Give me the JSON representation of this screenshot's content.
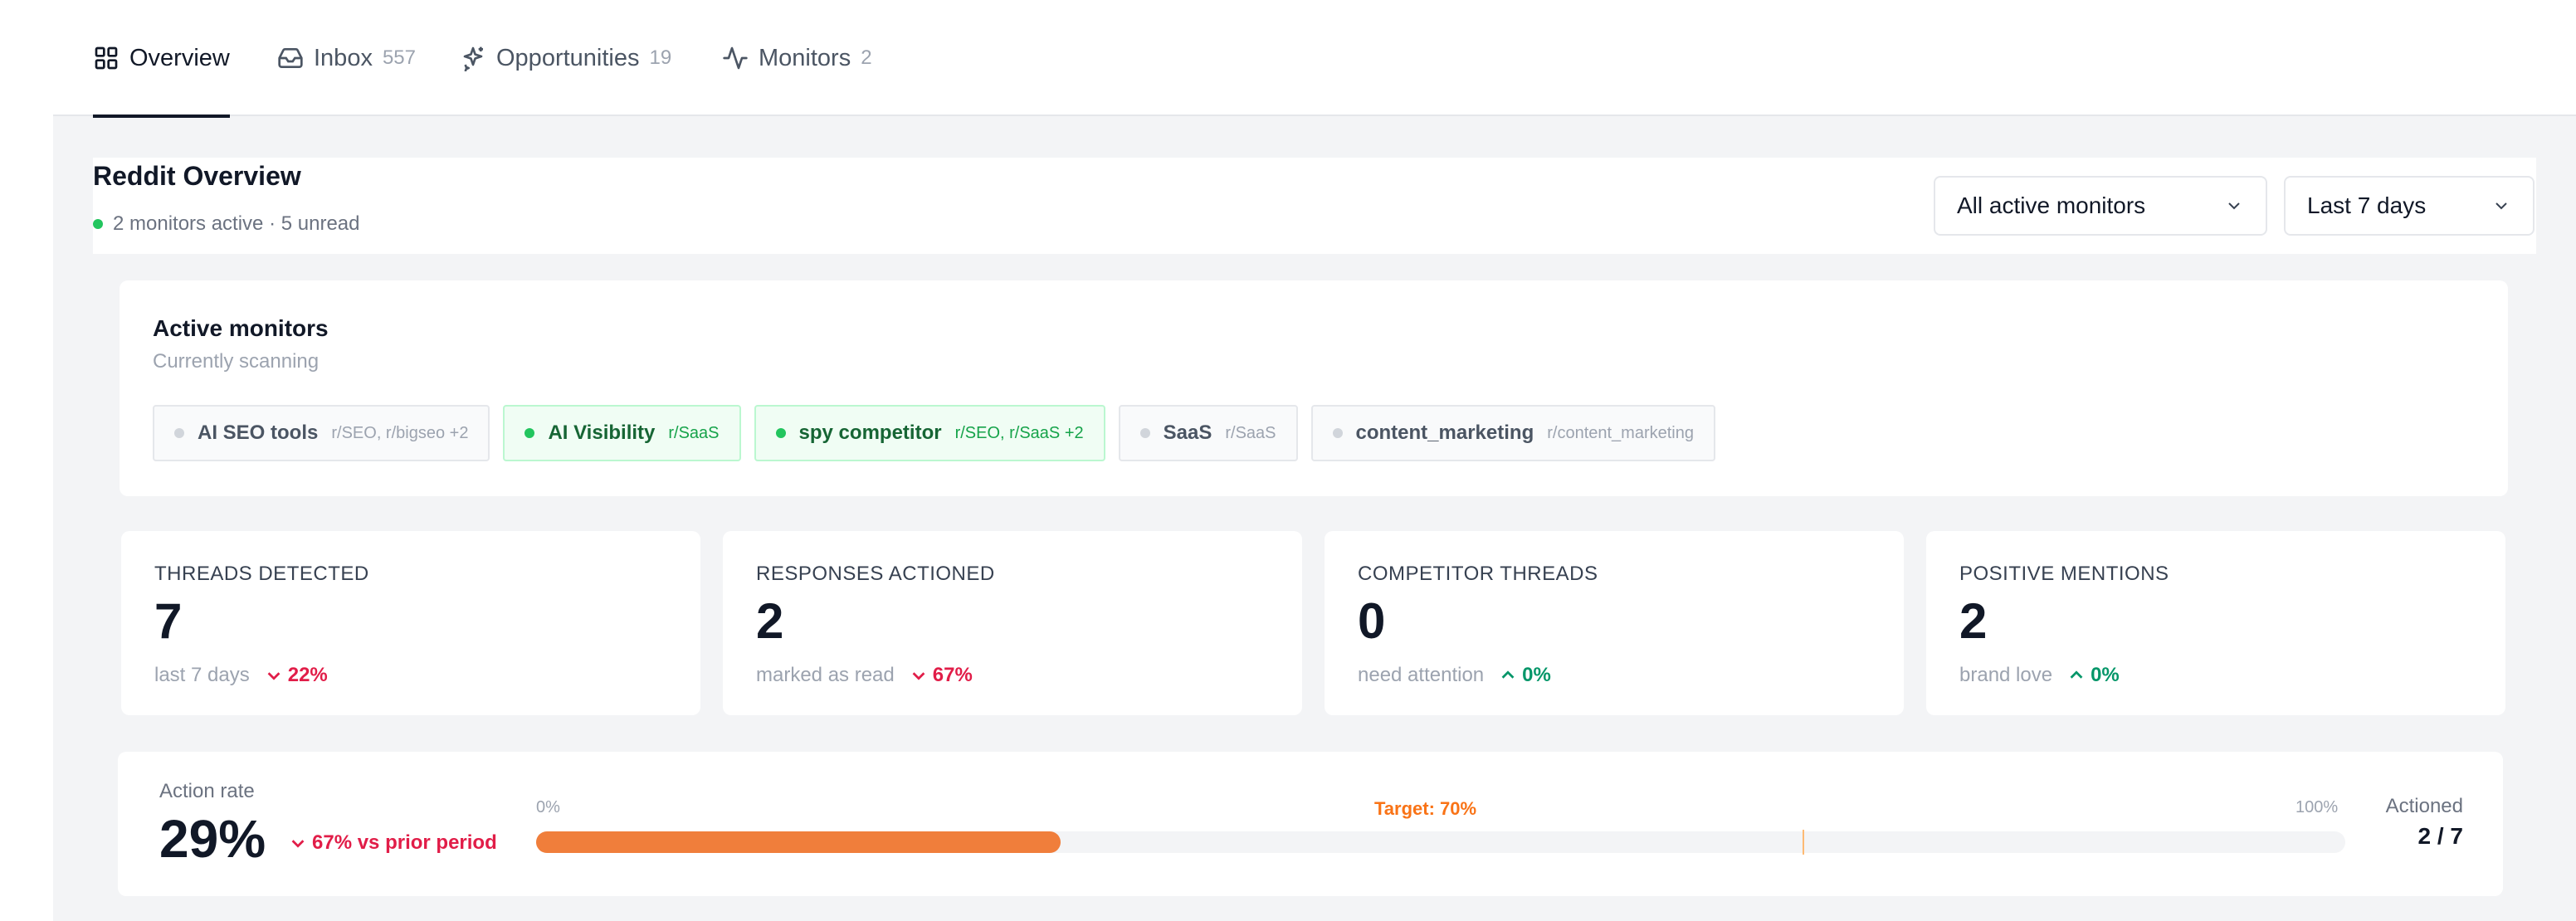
{
  "tabs": [
    {
      "label": "Overview",
      "count": "",
      "icon": "grid-icon",
      "active": true
    },
    {
      "label": "Inbox",
      "count": "557",
      "icon": "inbox-icon",
      "active": false
    },
    {
      "label": "Opportunities",
      "count": "19",
      "icon": "sparkle-icon",
      "active": false
    },
    {
      "label": "Monitors",
      "count": "2",
      "icon": "activity-icon",
      "active": false
    }
  ],
  "header": {
    "title": "Reddit Overview",
    "status": "2 monitors active · 5 unread",
    "monitor_filter": "All active monitors",
    "date_filter": "Last 7 days"
  },
  "monitors_card": {
    "title": "Active monitors",
    "subtitle": "Currently scanning",
    "chips": [
      {
        "name": "AI SEO tools",
        "subs": "r/SEO, r/bigseo +2",
        "active": false
      },
      {
        "name": "AI Visibility",
        "subs": "r/SaaS",
        "active": true
      },
      {
        "name": "spy competitor",
        "subs": "r/SEO, r/SaaS +2",
        "active": true
      },
      {
        "name": "SaaS",
        "subs": "r/SaaS",
        "active": false
      },
      {
        "name": "content_marketing",
        "subs": "r/content_marketing",
        "active": false
      }
    ]
  },
  "stats": [
    {
      "label": "THREADS DETECTED",
      "value": "7",
      "foot": "last 7 days",
      "delta": "22%",
      "direction": "down"
    },
    {
      "label": "RESPONSES ACTIONED",
      "value": "2",
      "foot": "marked as read",
      "delta": "67%",
      "direction": "down"
    },
    {
      "label": "COMPETITOR THREADS",
      "value": "0",
      "foot": "need attention",
      "delta": "0%",
      "direction": "up"
    },
    {
      "label": "POSITIVE MENTIONS",
      "value": "2",
      "foot": "brand love",
      "delta": "0%",
      "direction": "up"
    }
  ],
  "action_rate": {
    "label": "Action rate",
    "value": "29%",
    "delta": "67% vs prior period",
    "progress": 0.29,
    "target": 0.7,
    "target_label": "Target: 70%",
    "min_label": "0%",
    "max_label": "100%",
    "actioned_label": "Actioned",
    "actioned_value": "2 / 7"
  },
  "colors": {
    "accent_orange": "#f07e3b",
    "active_green": "#22c55e",
    "delta_down": "#e11d48",
    "delta_up": "#059669"
  }
}
